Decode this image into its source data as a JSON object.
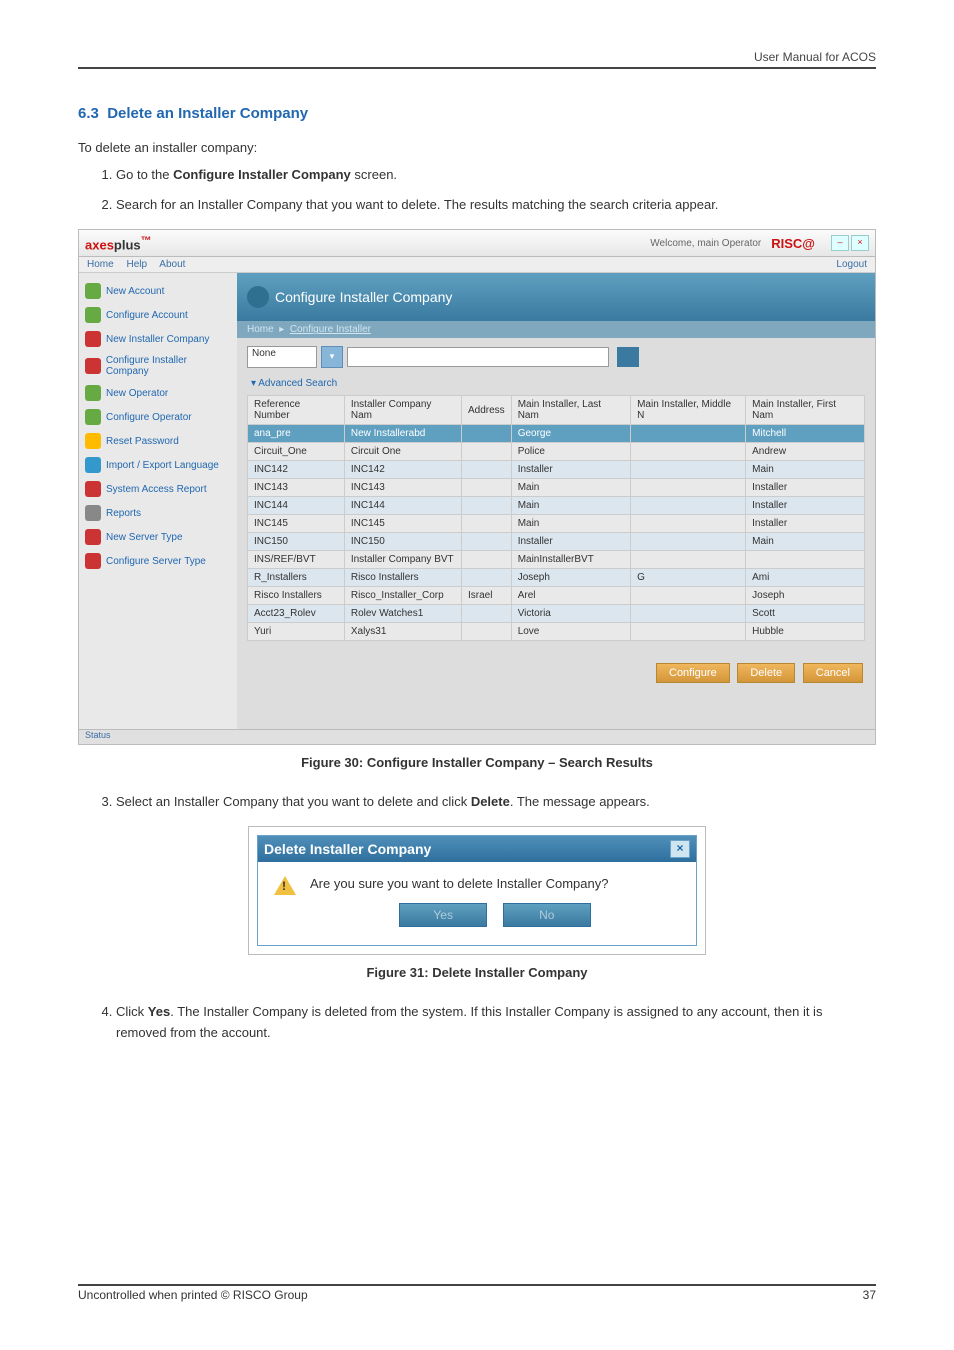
{
  "header": {
    "doc_title": "User Manual for ACOS"
  },
  "section": {
    "number": "6.3",
    "title": "Delete an Installer Company",
    "intro": "To delete an installer company:",
    "steps": {
      "s1_a": "Go to the ",
      "s1_b": "Configure Installer Company",
      "s1_c": " screen.",
      "s2": "Search for an Installer Company that you want to delete. The results matching the search criteria appear.",
      "s3_a": "Select an Installer Company that you want to delete and click ",
      "s3_b": "Delete",
      "s3_c": ". The message appears.",
      "s4_a": "Click ",
      "s4_b": "Yes",
      "s4_c": ". The Installer Company is deleted from the system. If this Installer Company is assigned to any account, then it is removed from the account."
    },
    "fig30": "Figure 30: Configure Installer Company – Search Results",
    "fig31": "Figure 31: Delete Installer Company"
  },
  "app": {
    "logo_a": "axes",
    "logo_b": "plus",
    "logo_sup": "™",
    "welcome": "Welcome, main Operator",
    "risco": "RISC@",
    "menu": {
      "home": "Home",
      "help": "Help",
      "about": "About",
      "logout": "Logout"
    },
    "sidebar": [
      "New Account",
      "Configure Account",
      "New Installer Company",
      "Configure Installer Company",
      "New Operator",
      "Configure Operator",
      "Reset Password",
      "Import / Export Language",
      "System Access Report",
      "Reports",
      "New Server Type",
      "Configure Server Type"
    ],
    "panel_title": "Configure Installer Company",
    "crumb_home": "Home",
    "crumb_cur": "Configure Installer",
    "search_field": "None",
    "adv": "Advanced Search",
    "cols": [
      "Reference Number",
      "Installer Company Nam",
      "Address",
      "Main Installer, Last Nam",
      "Main Installer, Middle N",
      "Main Installer, First Nam"
    ],
    "rows": [
      [
        "ana_pre",
        "New Installerabd",
        "",
        "George",
        "",
        "Mitchell"
      ],
      [
        "Circuit_One",
        "Circuit One",
        "",
        "Police",
        "",
        "Andrew"
      ],
      [
        "INC142",
        "INC142",
        "",
        "Installer",
        "",
        "Main"
      ],
      [
        "INC143",
        "INC143",
        "",
        "Main",
        "",
        "Installer"
      ],
      [
        "INC144",
        "INC144",
        "",
        "Main",
        "",
        "Installer"
      ],
      [
        "INC145",
        "INC145",
        "",
        "Main",
        "",
        "Installer"
      ],
      [
        "INC150",
        "INC150",
        "",
        "Installer",
        "",
        "Main"
      ],
      [
        "INS/REF/BVT",
        "Installer Company BVT",
        "",
        "MainInstallerBVT",
        "",
        ""
      ],
      [
        "R_Installers",
        "Risco Installers",
        "",
        "Joseph",
        "G",
        "Ami"
      ],
      [
        "Risco Installers",
        "Risco_Installer_Corp",
        "Israel",
        "Arel",
        "",
        "Joseph"
      ],
      [
        "Acct23_Rolev",
        "Rolev Watches1",
        "",
        "Victoria",
        "",
        "Scott"
      ],
      [
        "Yuri",
        "Xalys31",
        "",
        "Love",
        "",
        "Hubble"
      ]
    ],
    "actions": {
      "configure": "Configure",
      "delete": "Delete",
      "cancel": "Cancel"
    },
    "status": "Status"
  },
  "dialog": {
    "title": "Delete Installer Company",
    "msg": "Are you sure you want to delete Installer Company?",
    "yes": "Yes",
    "no": "No"
  },
  "footer": {
    "left": "Uncontrolled when printed © RISCO Group",
    "page": "37"
  }
}
